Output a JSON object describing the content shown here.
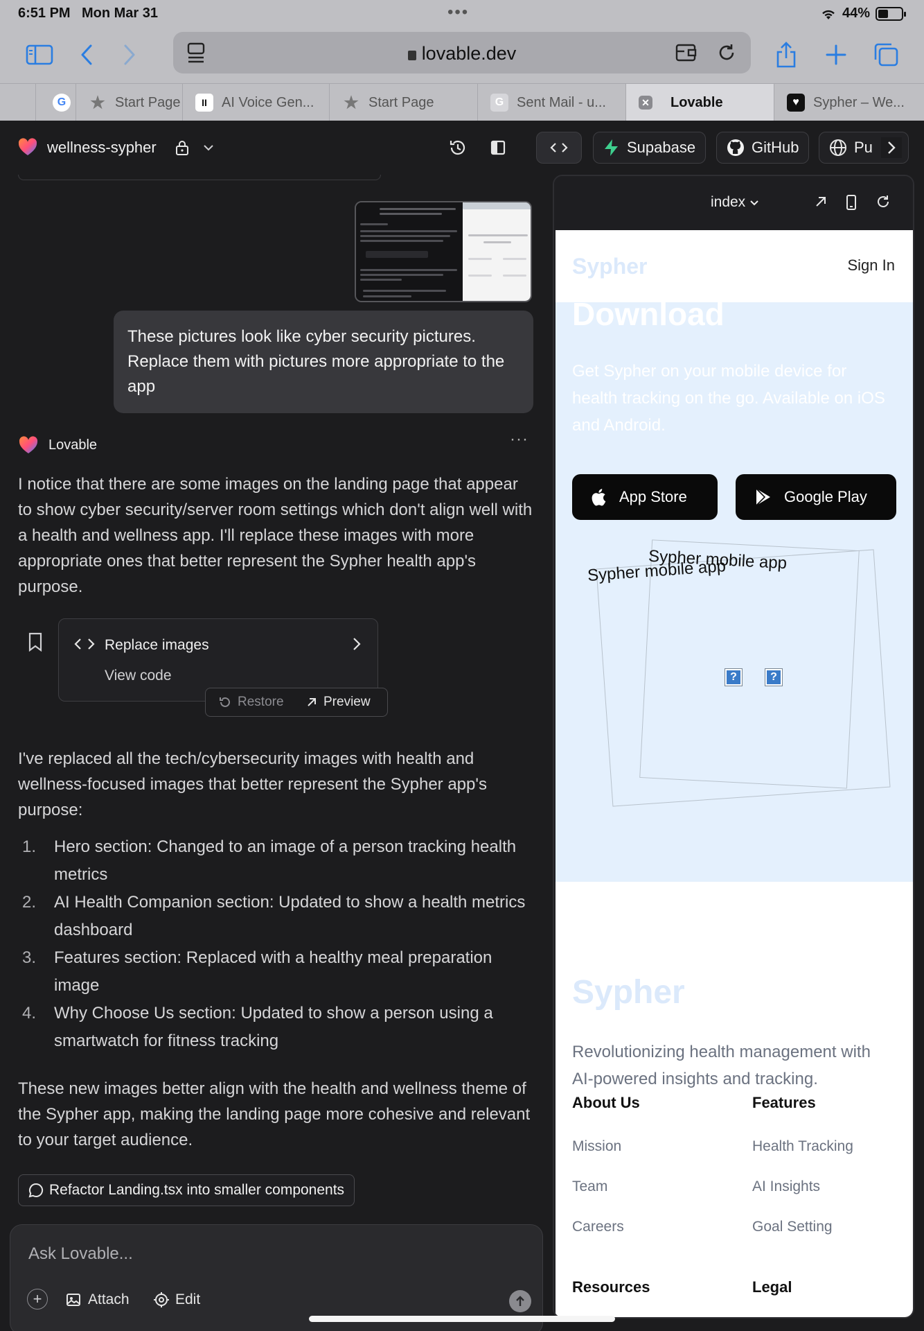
{
  "status_bar": {
    "time": "6:51 PM",
    "date": "Mon Mar 31",
    "battery": "44%"
  },
  "browser": {
    "url": "lovable.dev",
    "tabs": [
      {
        "label": "",
        "favicon": "google-icon",
        "active": false
      },
      {
        "label": "Start Page",
        "favicon": "star-icon",
        "active": false
      },
      {
        "label": "AI Voice Gen...",
        "favicon": "pause-icon",
        "active": false
      },
      {
        "label": "Start Page",
        "favicon": "star-icon",
        "active": false
      },
      {
        "label": "Sent Mail - u...",
        "favicon": "gmail-icon",
        "active": false
      },
      {
        "label": "Lovable",
        "favicon": "close-icon",
        "active": true
      },
      {
        "label": "Sypher – We...",
        "favicon": "heart-icon",
        "active": false
      }
    ]
  },
  "app_header": {
    "project_name": "wellness-sypher",
    "supabase_label": "Supabase",
    "github_label": "GitHub",
    "publish_label": "Pu"
  },
  "chat": {
    "user_message": "These pictures look like cyber security pictures. Replace them with pictures more appropriate to the app",
    "bot_name": "Lovable",
    "intro": "I notice that there are some images on the landing page that appear to show cyber security/server room settings which don't align well with a health and wellness app. I'll replace these images with more appropriate ones that better represent the Sypher health app's purpose.",
    "code_card": {
      "title": "Replace images",
      "view_code": "View code",
      "restore": "Restore",
      "preview": "Preview"
    },
    "summary": "I've replaced all the tech/cybersecurity images with health and wellness-focused images that better represent the Sypher app's purpose:",
    "list": [
      {
        "num": "1.",
        "text": "Hero section: Changed to an image of a person tracking health metrics"
      },
      {
        "num": "2.",
        "text": "AI Health Companion section: Updated to show a health metrics dashboard"
      },
      {
        "num": "3.",
        "text": "Features section: Replaced with a healthy meal preparation image"
      },
      {
        "num": "4.",
        "text": "Why Choose Us section: Updated to show a person using a smartwatch for fitness tracking"
      }
    ],
    "closing": "These new images better align with the health and wellness theme of the Sypher app, making the landing page more cohesive and relevant to your target audience.",
    "suggestion": "Refactor Landing.tsx into smaller components",
    "composer": {
      "placeholder": "Ask Lovable...",
      "attach": "Attach",
      "edit": "Edit"
    }
  },
  "preview": {
    "route": "index",
    "site": {
      "logo": "Sypher",
      "sign_in": "Sign In",
      "download_heading": "Download",
      "download_desc": "Get Sypher on your mobile device for health tracking on the go. Available on iOS and Android.",
      "app_store": "App Store",
      "google_play": "Google Play",
      "mock_label_1": "Sypher mobile app",
      "mock_label_2": "Sypher mobile app",
      "footer_brand": "Sypher",
      "footer_tagline": "Revolutionizing health management with AI-powered insights and tracking.",
      "about": {
        "heading": "About Us",
        "links": [
          "Mission",
          "Team",
          "Careers"
        ]
      },
      "features": {
        "heading": "Features",
        "links": [
          "Health Tracking",
          "AI Insights",
          "Goal Setting"
        ]
      },
      "resources_heading": "Resources",
      "legal_heading": "Legal"
    }
  },
  "colors": {
    "accent": "#2a7de1",
    "chat_bg": "#1c1c1e",
    "hero_bg": "#e4f0fd",
    "supabase_green": "#3ecf8e"
  }
}
